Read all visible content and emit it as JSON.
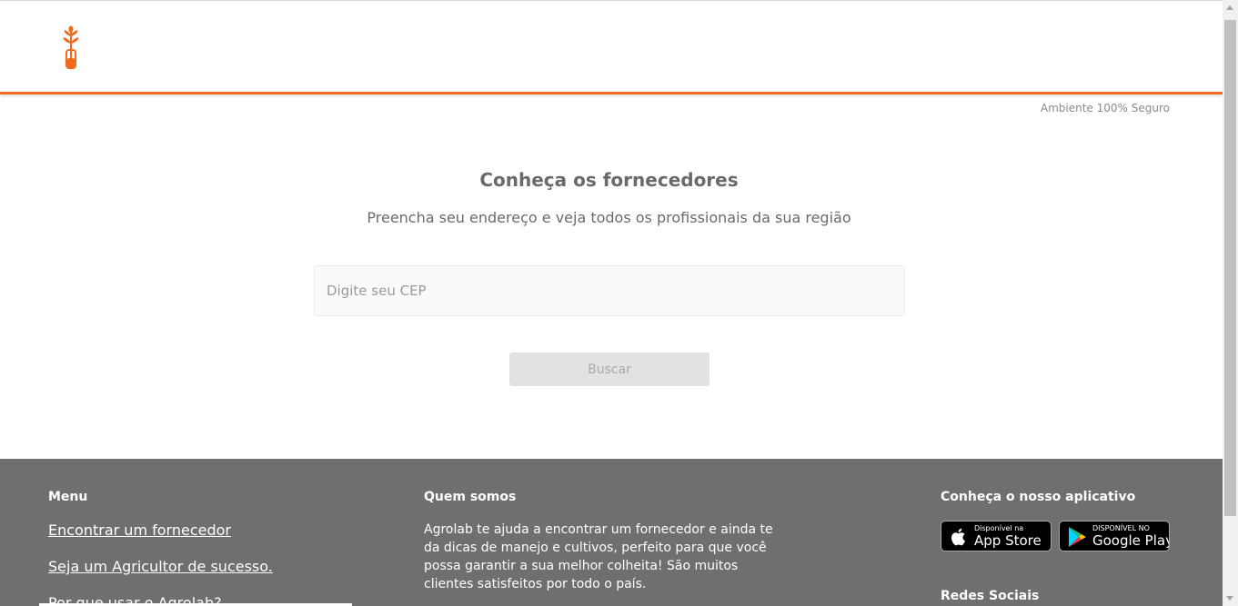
{
  "header": {
    "logo_icon": "plant-in-test-tube-icon",
    "brand_color": "#f26b1d",
    "secure_label": "Ambiente 100% Seguro"
  },
  "main": {
    "title": "Conheça os fornecedores",
    "subtitle": "Preencha seu endereço e veja todos os profissionais da sua região",
    "cep_placeholder": "Digite seu CEP",
    "cep_value": "",
    "search_button": "Buscar"
  },
  "footer": {
    "background": "#6f6f6f",
    "menu_title": "Menu",
    "menu_links": [
      "Encontrar um fornecedor",
      "Seja um Agricultor de sucesso.",
      "Por que usar o Agrolab?"
    ],
    "about_title": "Quem somos",
    "about_text": "Agrolab te ajuda a encontrar um fornecedor e ainda te da dicas de manejo e cultivos, perfeito para que você possa garantir a sua melhor colheita! São muitos clientes satisfeitos por todo o país.",
    "app_title": "Conheça o nosso aplicativo",
    "app_store": {
      "small": "Disponível na",
      "big": "App Store",
      "icon": "apple-icon"
    },
    "google_play": {
      "small": "DISPONÍVEL NO",
      "big": "Google Play",
      "icon": "google-play-icon"
    },
    "social_title": "Redes Sociais"
  }
}
